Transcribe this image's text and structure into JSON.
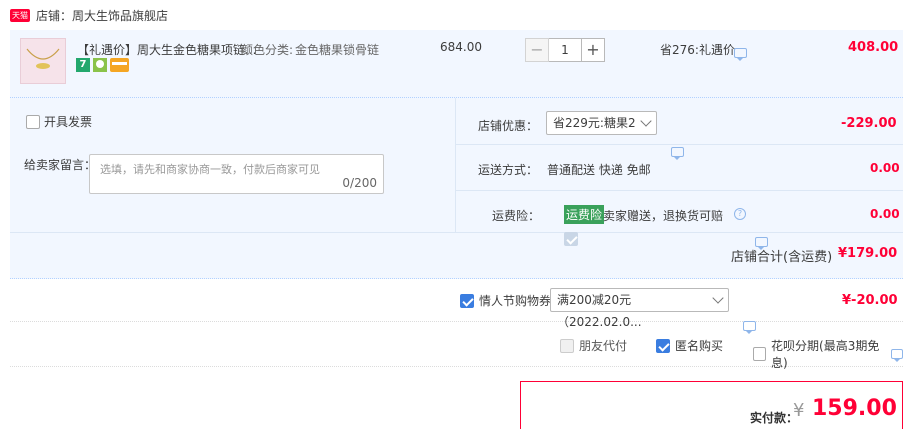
{
  "shop": {
    "badge": "天猫",
    "label": "店铺：",
    "name": "周大生饰品旗舰店"
  },
  "item": {
    "title": "【礼遇价】周大生金色糖果项链...",
    "sku_label": "颜色分类:",
    "sku_value": "金色糖果锁骨链",
    "price": "684.00",
    "qty": "1",
    "minus": "−",
    "plus": "+",
    "discount": "省276:礼遇价",
    "subtotal": "408.00",
    "tag_number": "7"
  },
  "invoice": {
    "label": "开具发票"
  },
  "message": {
    "label": "给卖家留言：",
    "placeholder": "选填，请先和商家协商一致，付款后商家可见",
    "count": "0/200"
  },
  "store_discount": {
    "label": "店铺优惠：",
    "selected": "省229元:糖果2",
    "amount": "-229.00"
  },
  "shipping": {
    "label": "运送方式：",
    "value": "普通配送 快递 免邮",
    "amount": "0.00"
  },
  "insurance": {
    "label": "运费险：",
    "badge": "运费险",
    "text": "卖家赠送，退换货可赔",
    "amount": "0.00"
  },
  "shop_total": {
    "label": "店铺合计(含运费)",
    "amount": "¥179.00"
  },
  "coupon": {
    "label": "情人节购物券",
    "selected": "满200减20元（2022.02.0...",
    "amount": "¥-20.00"
  },
  "options": {
    "friend_pay": "朋友代付",
    "anonymous": "匿名购买",
    "huabei": "花呗分期(最高3期免息)"
  },
  "pay": {
    "label": "实付款：",
    "currency": "¥",
    "amount": "159.00"
  },
  "colors": {
    "accent": "#ff0036",
    "rows_bg": "#f2f7ff",
    "border": "#b2d1ff"
  }
}
